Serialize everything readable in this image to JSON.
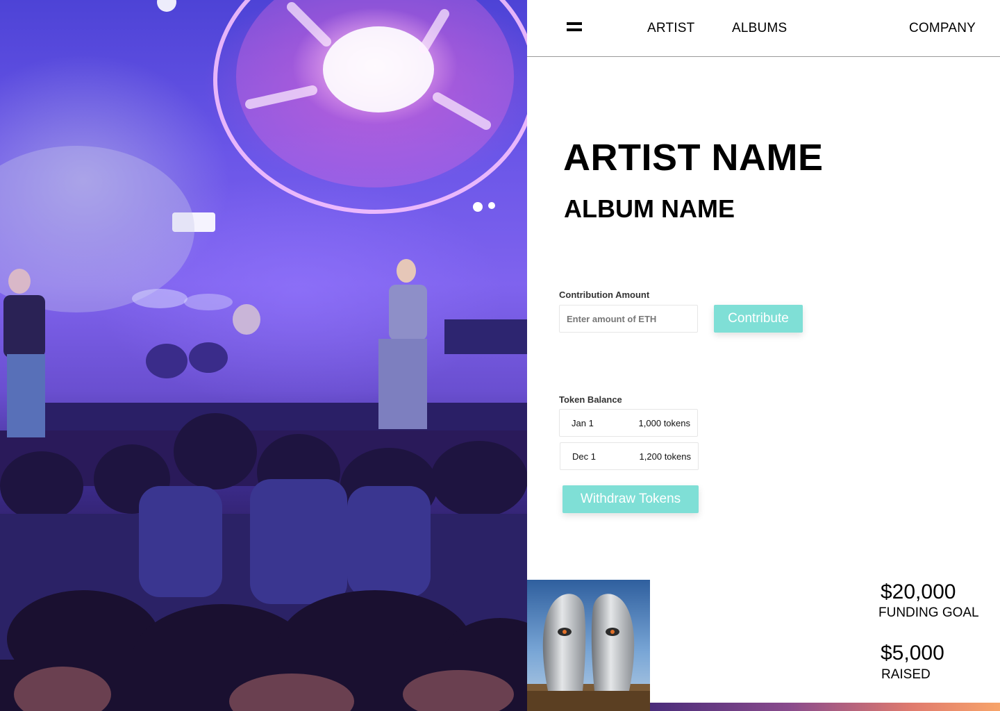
{
  "nav": {
    "menu_icon": "hamburger-menu-icon",
    "links": [
      "ARTIST",
      "ALBUMS",
      "COMPANY"
    ]
  },
  "hero": {
    "title": "ARTIST NAME",
    "subtitle": "ALBUM NAME"
  },
  "contribution": {
    "label": "Contribution Amount",
    "input_placeholder": "Enter amount of ETH",
    "input_value": "",
    "button_label": "Contribute"
  },
  "token_balance": {
    "label": "Token Balance",
    "rows": [
      {
        "date": "Jan 1",
        "amount": "1,000 tokens"
      },
      {
        "date": "Dec 1",
        "amount": "1,200 tokens"
      }
    ],
    "withdraw_label": "Withdraw Tokens"
  },
  "funding": {
    "goal_value": "$20,000",
    "goal_label": "FUNDING GOAL",
    "raised_value": "$5,000",
    "raised_label": "RAISED"
  },
  "colors": {
    "accent": "#7fdfd6",
    "text": "#000000",
    "gradient": [
      "#4a2c7a",
      "#8a4b8c",
      "#e07b6e",
      "#f7a46a"
    ]
  }
}
